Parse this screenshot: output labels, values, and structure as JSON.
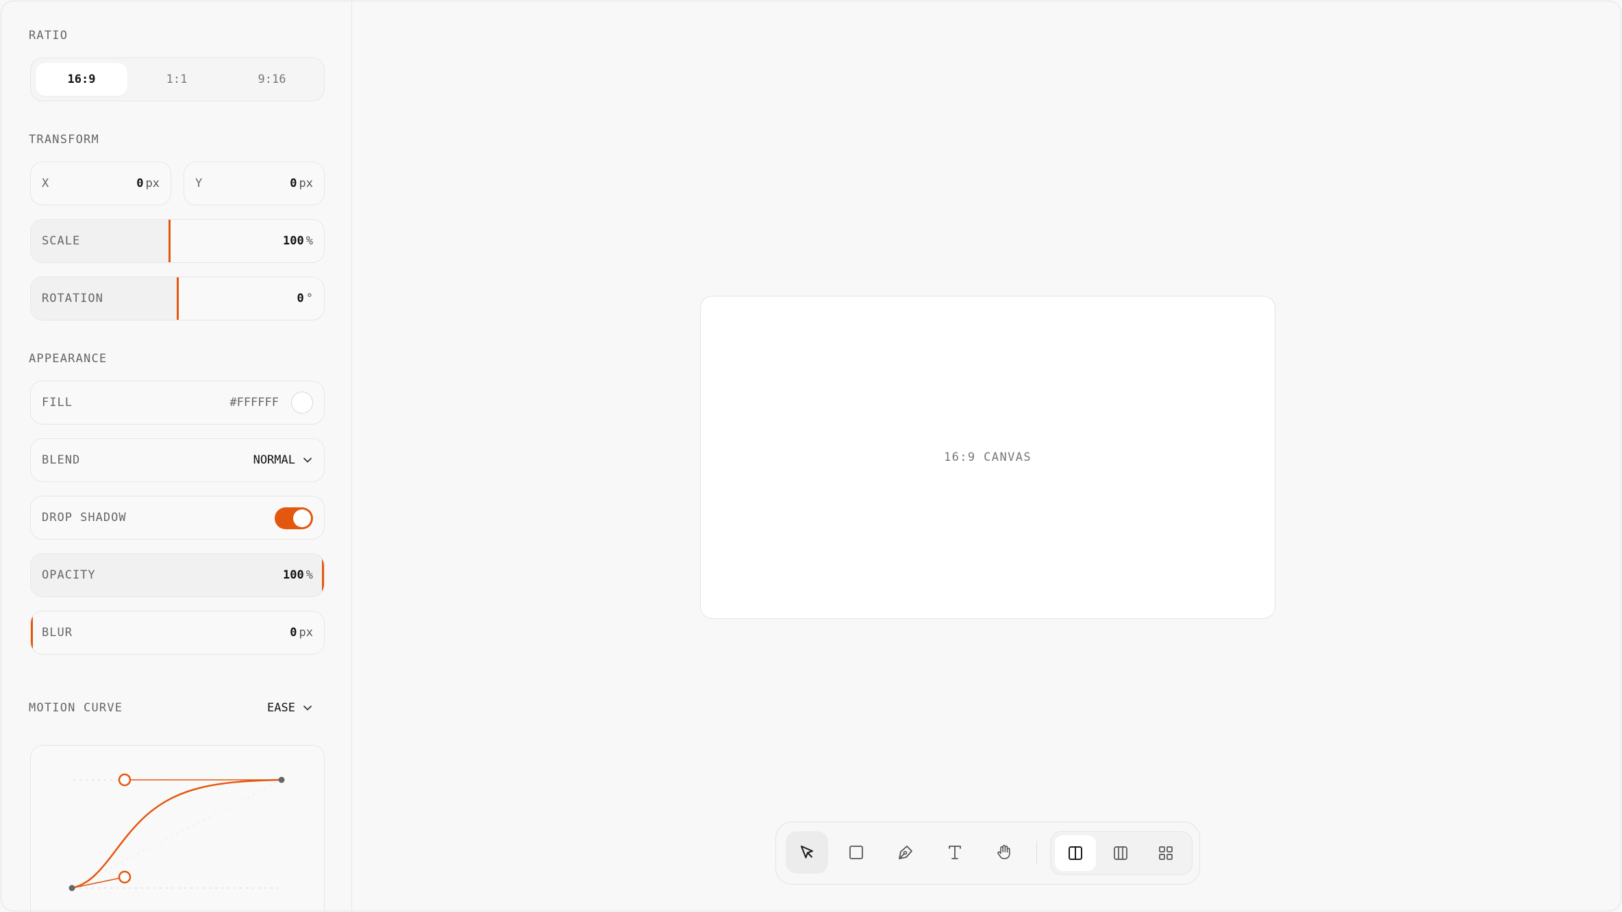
{
  "sidebar": {
    "ratio": {
      "title": "RATIO",
      "options": [
        "16:9",
        "1:1",
        "9:16"
      ],
      "selected": "16:9"
    },
    "transform": {
      "title": "TRANSFORM",
      "x": {
        "label": "X",
        "value": "0",
        "unit": "px"
      },
      "y": {
        "label": "Y",
        "value": "0",
        "unit": "px"
      },
      "scale": {
        "label": "SCALE",
        "value": "100",
        "unit": "%"
      },
      "rotation": {
        "label": "ROTATION",
        "value": "0",
        "unit": "°"
      }
    },
    "appearance": {
      "title": "APPEARANCE",
      "fill": {
        "label": "FILL",
        "value": "#FFFFFF"
      },
      "blend": {
        "label": "BLEND",
        "value": "NORMAL"
      },
      "drop_shadow": {
        "label": "DROP SHADOW",
        "enabled": true
      },
      "opacity": {
        "label": "OPACITY",
        "value": "100",
        "unit": "%"
      },
      "blur": {
        "label": "BLUR",
        "value": "0",
        "unit": "px"
      }
    },
    "motion": {
      "title": "MOTION CURVE",
      "value": "EASE"
    }
  },
  "canvas": {
    "label": "16:9 CANVAS"
  },
  "toolbar": {
    "tools": [
      "pointer-icon",
      "rectangle-icon",
      "pen-icon",
      "text-icon",
      "hand-icon"
    ],
    "active_tool": "pointer-icon",
    "views": [
      "split-view-icon",
      "columns-view-icon",
      "grid-view-icon"
    ],
    "active_view": "split-view-icon"
  },
  "colors": {
    "accent": "#E4570E",
    "background": "#F8F8F8",
    "panel": "#F9F9F9"
  }
}
